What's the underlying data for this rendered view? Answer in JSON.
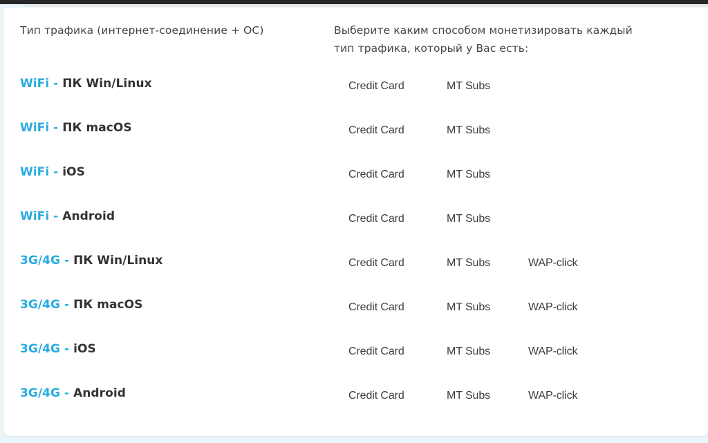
{
  "page": {
    "background_color": "#e9f4fb",
    "card_background": "#ffffff",
    "accent_color": "#29abe2",
    "text_color": "#333333",
    "topbar_color": "#272727"
  },
  "headers": {
    "left": "Тип трафика (интернет-соединение + ОС)",
    "right": "Выберите каким способом монетизировать каждый тип трафика, который у Вас есть:"
  },
  "columns": [
    "Credit Card",
    "MT Subs",
    "WAP-click"
  ],
  "rows": [
    {
      "connection": "WiFi",
      "separator": "-",
      "os": "ПК Win/Linux",
      "options": [
        "Credit Card",
        "MT Subs"
      ]
    },
    {
      "connection": "WiFi",
      "separator": "-",
      "os": "ПК macOS",
      "options": [
        "Credit Card",
        "MT Subs"
      ]
    },
    {
      "connection": "WiFi",
      "separator": "-",
      "os": "iOS",
      "options": [
        "Credit Card",
        "MT Subs"
      ]
    },
    {
      "connection": "WiFi",
      "separator": "-",
      "os": "Android",
      "options": [
        "Credit Card",
        "MT Subs"
      ]
    },
    {
      "connection": "3G/4G",
      "separator": "-",
      "os": "ПК Win/Linux",
      "options": [
        "Credit Card",
        "MT Subs",
        "WAP-click"
      ]
    },
    {
      "connection": "3G/4G",
      "separator": "-",
      "os": "ПК macOS",
      "options": [
        "Credit Card",
        "MT Subs",
        "WAP-click"
      ]
    },
    {
      "connection": "3G/4G",
      "separator": "-",
      "os": "iOS",
      "options": [
        "Credit Card",
        "MT Subs",
        "WAP-click"
      ]
    },
    {
      "connection": "3G/4G",
      "separator": "-",
      "os": "Android",
      "options": [
        "Credit Card",
        "MT Subs",
        "WAP-click"
      ]
    }
  ]
}
